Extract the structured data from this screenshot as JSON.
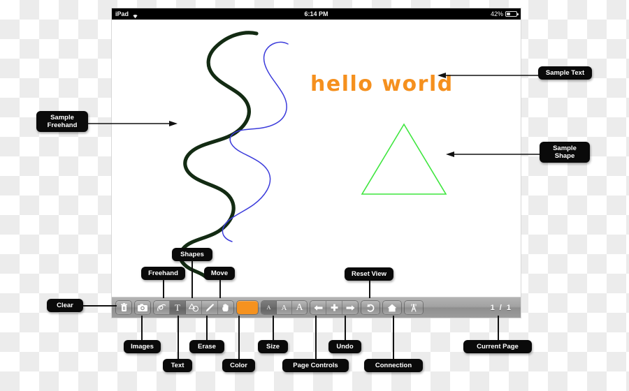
{
  "status_bar": {
    "device": "iPad",
    "wifi_icon": "wifi-icon",
    "time": "6:14 PM",
    "battery_percent": "42%",
    "battery_icon": "battery-icon"
  },
  "canvas": {
    "text_object": "hello world",
    "text_color": "#f5901e",
    "shape": "triangle",
    "shape_color": "#3fe63f",
    "strokes": [
      {
        "name": "dark-freehand-stroke",
        "color": "#132b13",
        "width": 5
      },
      {
        "name": "blue-freehand-stroke",
        "color": "#3b3bdb",
        "width": 1.4
      }
    ]
  },
  "toolbar": {
    "buttons": [
      {
        "name": "clear-button",
        "icon": "trash-icon",
        "label": "Clear",
        "selected": false
      },
      {
        "name": "images-button",
        "icon": "camera-icon",
        "label": "Images",
        "selected": false
      },
      {
        "name": "freehand-button",
        "icon": "squiggle-icon",
        "label": "Freehand",
        "selected": false
      },
      {
        "name": "text-button",
        "icon": "text-t-icon",
        "label": "Text",
        "selected": true
      },
      {
        "name": "shapes-button",
        "icon": "shapes-icon",
        "label": "Shapes",
        "selected": false
      },
      {
        "name": "erase-button",
        "icon": "eraser-icon",
        "label": "Erase",
        "selected": false
      },
      {
        "name": "move-button",
        "icon": "hand-icon",
        "label": "Move",
        "selected": false
      },
      {
        "name": "color-button",
        "icon": "color-swatch-icon",
        "label": "Color",
        "selected": false
      },
      {
        "name": "size-small-button",
        "icon": "letter-a-small-icon",
        "label": "Size",
        "selected": true
      },
      {
        "name": "size-medium-button",
        "icon": "letter-a-medium-icon",
        "label": "Size",
        "selected": false
      },
      {
        "name": "size-large-button",
        "icon": "letter-a-large-icon",
        "label": "Size",
        "selected": false
      },
      {
        "name": "page-prev-button",
        "icon": "arrow-left-icon",
        "label": "Page Controls",
        "selected": false
      },
      {
        "name": "page-add-button",
        "icon": "plus-icon",
        "label": "Page Controls",
        "selected": false
      },
      {
        "name": "page-next-button",
        "icon": "arrow-right-icon",
        "label": "Page Controls",
        "selected": false
      },
      {
        "name": "undo-button",
        "icon": "undo-arrow-icon",
        "label": "Undo",
        "selected": false
      },
      {
        "name": "reset-view-button",
        "icon": "home-icon",
        "label": "Reset View",
        "selected": false
      },
      {
        "name": "connection-button",
        "icon": "broadcast-tower-icon",
        "label": "Connection",
        "selected": false
      }
    ],
    "size_labels": {
      "small": "A",
      "medium": "A",
      "large": "A"
    },
    "page_indicator": "1 / 1",
    "color_swatch_hex": "#f5921f"
  },
  "callouts": {
    "sample_freehand": "Sample\nFreehand",
    "sample_text": "Sample Text",
    "sample_shape": "Sample\nShape",
    "shapes": "Shapes",
    "freehand": "Freehand",
    "move": "Move",
    "reset_view": "Reset View",
    "clear": "Clear",
    "images": "Images",
    "text": "Text",
    "erase": "Erase",
    "color": "Color",
    "size": "Size",
    "page_controls": "Page Controls",
    "undo": "Undo",
    "connection": "Connection",
    "current_page": "Current Page"
  }
}
